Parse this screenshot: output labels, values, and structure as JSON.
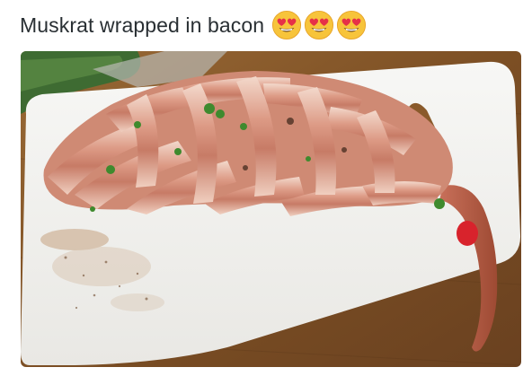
{
  "post": {
    "caption": "Muskrat wrapped in bacon",
    "emojis": [
      "heart-eyes-face",
      "heart-eyes-face",
      "heart-eyes-face"
    ],
    "photo": {
      "subject": "bacon-wrapped-muskrat-on-cutting-board",
      "colors": {
        "board": "#f4f4f2",
        "wood": "#8a5a2b",
        "bacon": "#d99a86",
        "bacon_fat": "#f2d7c9",
        "tail": "#b25a3e"
      }
    }
  }
}
